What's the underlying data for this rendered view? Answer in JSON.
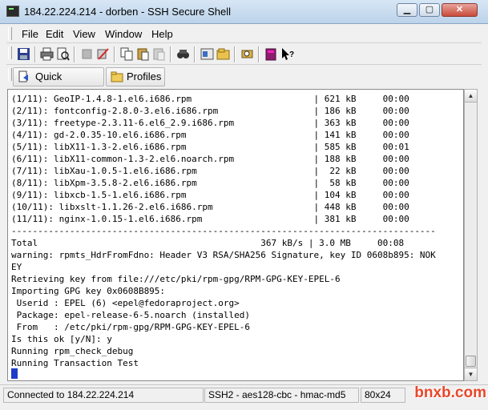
{
  "window": {
    "title": "184.22.224.214 - dorben - SSH Secure Shell",
    "minimize_glyph": "▁",
    "maximize_glyph": "▢",
    "close_glyph": "✕"
  },
  "menu": [
    "File",
    "Edit",
    "View",
    "Window",
    "Help"
  ],
  "toolbar": {
    "icons": [
      "save-icon",
      "print-icon",
      "print-preview-icon",
      "disconnect-icon",
      "connect-icon",
      "copy-icon",
      "paste-icon",
      "paste-disabled-icon",
      "find-icon",
      "settings-icon",
      "profiles-icon",
      "sftp-icon",
      "help-book-icon",
      "context-help-icon"
    ]
  },
  "quickbar": {
    "quick_connect": "Quick Connect",
    "profiles": "Profiles"
  },
  "terminal": {
    "lines": [
      "(1/11): GeoIP-1.4.8-1.el6.i686.rpm                       | 621 kB     00:00",
      "(2/11): fontconfig-2.8.0-3.el6.i686.rpm                  | 186 kB     00:00",
      "(3/11): freetype-2.3.11-6.el6_2.9.i686.rpm               | 363 kB     00:00",
      "(4/11): gd-2.0.35-10.el6.i686.rpm                        | 141 kB     00:00",
      "(5/11): libX11-1.3-2.el6.i686.rpm                        | 585 kB     00:01",
      "(6/11): libX11-common-1.3-2.el6.noarch.rpm               | 188 kB     00:00",
      "(7/11): libXau-1.0.5-1.el6.i686.rpm                      |  22 kB     00:00",
      "(8/11): libXpm-3.5.8-2.el6.i686.rpm                      |  58 kB     00:00",
      "(9/11): libxcb-1.5-1.el6.i686.rpm                        | 104 kB     00:00",
      "(10/11): libxslt-1.1.26-2.el6.i686.rpm                   | 448 kB     00:00",
      "(11/11): nginx-1.0.15-1.el6.i686.rpm                     | 381 kB     00:00",
      "--------------------------------------------------------------------------------",
      "Total                                          367 kB/s | 3.0 MB     00:08",
      "warning: rpmts_HdrFromFdno: Header V3 RSA/SHA256 Signature, key ID 0608b895: NOK",
      "EY",
      "Retrieving key from file:///etc/pki/rpm-gpg/RPM-GPG-KEY-EPEL-6",
      "Importing GPG key 0x0608B895:",
      " Userid : EPEL (6) <epel@fedoraproject.org>",
      " Package: epel-release-6-5.noarch (installed)",
      " From   : /etc/pki/rpm-gpg/RPM-GPG-KEY-EPEL-6",
      "Is this ok [y/N]: y",
      "Running rpm_check_debug",
      "Running Transaction Test"
    ]
  },
  "scrollbar": {
    "up_glyph": "▲",
    "down_glyph": "▼"
  },
  "status": {
    "connection": "Connected to 184.22.224.214",
    "cipher": "SSH2 - aes128-cbc - hmac-md5",
    "size": "80x24"
  },
  "watermark": "bnxb.com",
  "colors": {
    "cursor": "#1f3cc9",
    "title_gradient_top": "#d7e6f5",
    "watermark": "#e8462a"
  }
}
